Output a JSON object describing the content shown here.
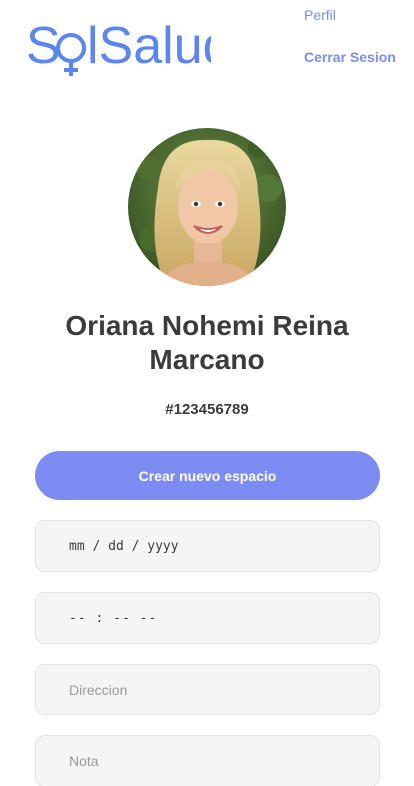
{
  "header": {
    "logo_text": "SolSalud",
    "nav": {
      "profile": "Perfil",
      "logout": "Cerrar Sesion"
    }
  },
  "profile": {
    "avatar_alt": "profile-photo",
    "name": "Oriana Nohemi Reina Marcano",
    "id": "#123456789"
  },
  "form": {
    "create_button": "Crear nuevo espacio",
    "date_placeholder": "mm / dd / yyyy",
    "time_placeholder": "-- : --  --",
    "address_placeholder": "Direccion",
    "note_placeholder": "Nota"
  },
  "colors": {
    "accent": "#7c8cf2",
    "logo": "#5b86f0",
    "field_bg": "#f5f5f5"
  },
  "icons": {
    "logo_symbol": "female-symbol-icon"
  }
}
